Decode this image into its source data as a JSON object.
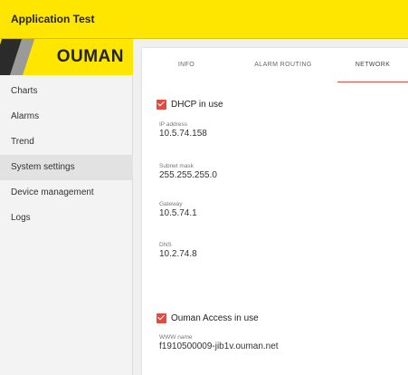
{
  "header": {
    "title": "Application Test"
  },
  "logo": {
    "text": "OUMAN"
  },
  "sidebar": {
    "items": [
      {
        "label": "Charts"
      },
      {
        "label": "Alarms"
      },
      {
        "label": "Trend"
      },
      {
        "label": "System settings",
        "active": true
      },
      {
        "label": "Device management"
      },
      {
        "label": "Logs"
      }
    ]
  },
  "tabs": [
    {
      "label": "INFO"
    },
    {
      "label": "ALARM ROUTING"
    },
    {
      "label": "NETWORK",
      "active": true
    }
  ],
  "network": {
    "dhcp": {
      "label": "DHCP in use",
      "checked": true
    },
    "ip": {
      "label": "IP address",
      "value": "10.5.74.158"
    },
    "subnet": {
      "label": "Subnet mask",
      "value": "255.255.255.0"
    },
    "gateway": {
      "label": "Gateway",
      "value": "10.5.74.1"
    },
    "dns": {
      "label": "DNS",
      "value": "10.2.74.8"
    },
    "access": {
      "label": "Ouman Access in use",
      "checked": true
    },
    "www": {
      "label": "WWW name",
      "value": "f1910500009-jib1v.ouman.net"
    }
  },
  "colors": {
    "brand_yellow": "#ffe600",
    "accent_red": "#e34b41"
  }
}
